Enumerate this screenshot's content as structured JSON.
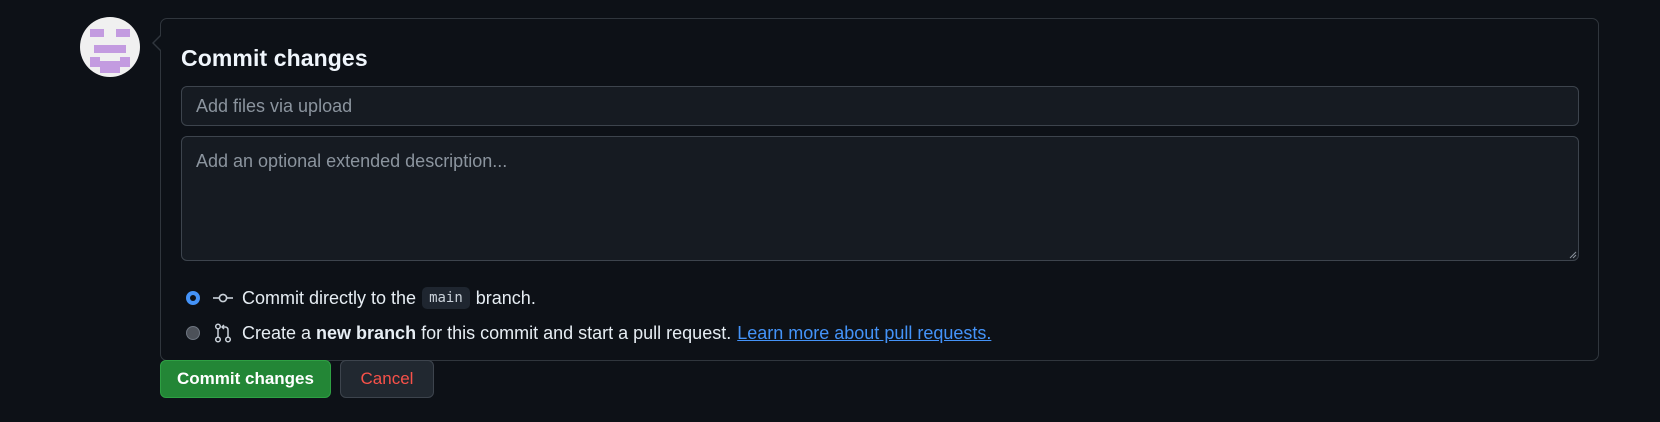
{
  "form": {
    "title": "Commit changes",
    "summary_placeholder": "Add files via upload",
    "summary_value": "",
    "description_placeholder": "Add an optional extended description...",
    "description_value": ""
  },
  "options": {
    "direct": {
      "checked": true,
      "prefix": "Commit directly to the",
      "branch": "main",
      "suffix": "branch."
    },
    "new_branch": {
      "checked": false,
      "prefix": "Create a",
      "bold": "new branch",
      "suffix": "for this commit and start a pull request.",
      "link": "Learn more about pull requests."
    }
  },
  "buttons": {
    "commit": "Commit changes",
    "cancel": "Cancel"
  },
  "icons": {
    "avatar": "identicon-avatar",
    "commit": "git-commit-icon",
    "pull_request": "git-pull-request-icon"
  },
  "colors": {
    "background": "#0d1117",
    "accent_link": "#4493f8",
    "commit_button": "#238636",
    "cancel_text": "#f85149"
  }
}
